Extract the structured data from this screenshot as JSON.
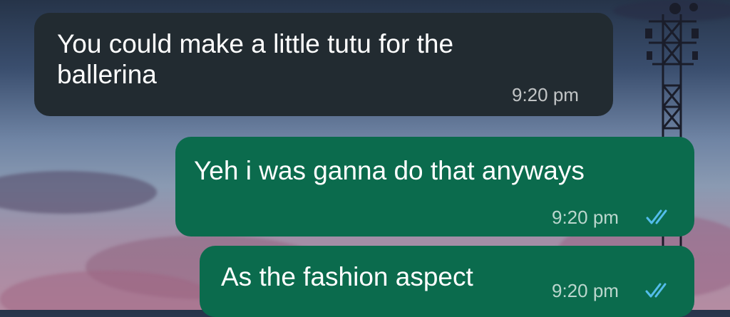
{
  "messages": [
    {
      "direction": "incoming",
      "text": "You could make a little tutu for the\nballerina",
      "time": "9:20 pm"
    },
    {
      "direction": "outgoing",
      "text": "Yeh i was ganna do that anyways",
      "time": "9:20 pm",
      "status_icon": "double-check-icon"
    },
    {
      "direction": "outgoing",
      "text": "As the fashion aspect",
      "time": "9:20 pm",
      "status_icon": "double-check-icon"
    }
  ],
  "colors": {
    "incoming_bubble": "#222b31",
    "outgoing_bubble": "#0b6b4d",
    "read_ticks": "#53bdeb"
  }
}
